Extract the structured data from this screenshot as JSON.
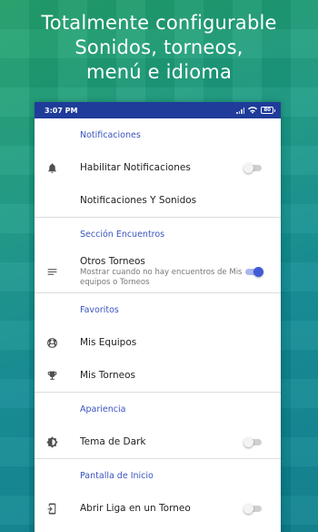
{
  "headline": {
    "line1": "Totalmente configurable",
    "line2": "Sonidos, torneos,",
    "line3": "menú e idioma"
  },
  "statusbar": {
    "time": "3:07 PM",
    "battery": "80"
  },
  "colors": {
    "accent": "#3f5bd8",
    "section_title": "#3a54c0",
    "statusbar": "#1f3c9a"
  },
  "sections": {
    "notificaciones": {
      "title": "Notificaciones",
      "habilitar": {
        "label": "Habilitar Notificaciones",
        "icon": "bell-icon",
        "enabled": false
      },
      "sonidos": {
        "label": "Notificaciones Y Sonidos"
      }
    },
    "encuentros": {
      "title": "Sección Encuentros",
      "otros_torneos": {
        "label": "Otros Torneos",
        "sublabel": "Mostrar cuando no hay encuentros de Mis equipos o Torneos",
        "icon": "list-icon",
        "enabled": true
      }
    },
    "favoritos": {
      "title": "Favoritos",
      "mis_equipos": {
        "label": "Mis Equipos",
        "icon": "soccer-ball-icon"
      },
      "mis_torneos": {
        "label": "Mis Torneos",
        "icon": "trophy-icon"
      }
    },
    "apariencia": {
      "title": "Apariencia",
      "tema": {
        "label": "Tema de Dark",
        "icon": "brightness-icon",
        "enabled": false
      }
    },
    "inicio": {
      "title": "Pantalla de Inicio",
      "abrir_liga": {
        "label": "Abrir Liga en un Torneo",
        "icon": "phone-link-icon",
        "enabled": false
      }
    }
  }
}
